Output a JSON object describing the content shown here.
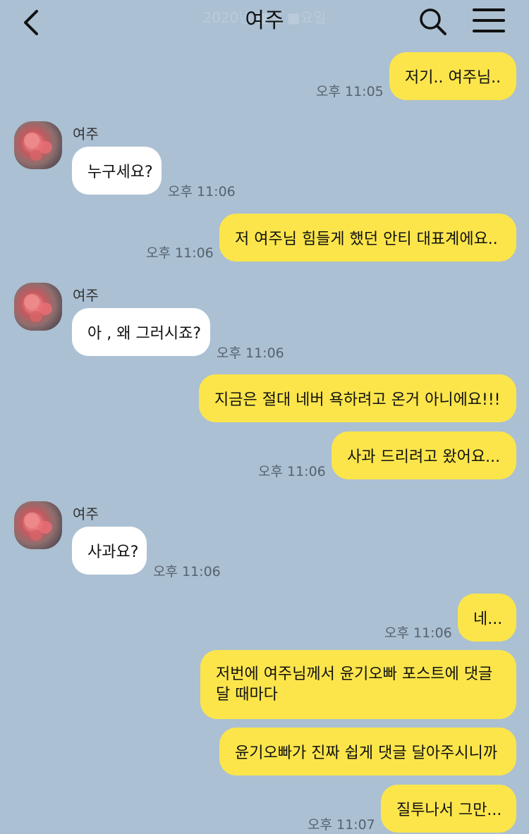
{
  "header": {
    "title": "여주",
    "date_ghost": "2020년 ■월 ■요일"
  },
  "contact": {
    "name": "여주"
  },
  "messages": [
    {
      "from": "me",
      "text": "저기.. 여주님..",
      "time": "오후 11:05"
    },
    {
      "from": "them",
      "text": "누구세요?",
      "time": "오후 11:06"
    },
    {
      "from": "me",
      "text": "저 여주님 힘들게 했던 안티 대표계에요..",
      "time": "오후 11:06"
    },
    {
      "from": "them",
      "text": "아 , 왜 그러시죠?",
      "time": "오후 11:06"
    },
    {
      "from": "me",
      "text": "지금은 절대 네버 욕하려고 온거 아니에요!!!",
      "time": ""
    },
    {
      "from": "me",
      "text": "사과 드리려고 왔어요...",
      "time": "오후 11:06"
    },
    {
      "from": "them",
      "text": "사과요?",
      "time": "오후 11:06"
    },
    {
      "from": "me",
      "text": "네...",
      "time": "오후 11:06"
    },
    {
      "from": "me",
      "text": "저번에 여주님께서 윤기오빠 포스트에 댓글 달 때마다",
      "time": ""
    },
    {
      "from": "me",
      "text": "윤기오빠가 진짜 쉽게 댓글 달아주시니까",
      "time": ""
    },
    {
      "from": "me",
      "text": "질투나서 그만...",
      "time": "오후 11:07"
    }
  ]
}
